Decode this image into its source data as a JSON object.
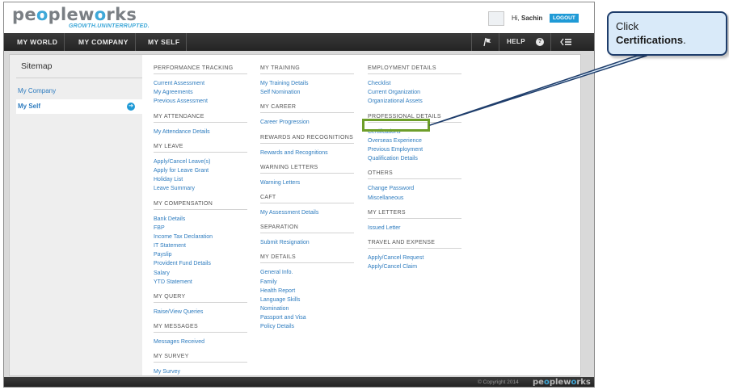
{
  "header": {
    "logo_word_a": "pe",
    "logo_word_b": "o",
    "logo_word_c": "ple",
    "logo_word_d": "w",
    "logo_word_e": "o",
    "logo_word_f": "rks",
    "tagline": "GROWTH.UNINTERRUPTED.",
    "greeting_prefix": "Hi, ",
    "user_name": "Sachin",
    "logout_label": "LOGOUT"
  },
  "nav": {
    "items": [
      "MY WORLD",
      "MY COMPANY",
      "MY SELF"
    ],
    "help_label": "HELP",
    "help_icon_glyph": "?"
  },
  "sidebar": {
    "title": "Sitemap",
    "items": [
      "My Company",
      "My Self"
    ],
    "active_arrow": "➔"
  },
  "columns": [
    [
      {
        "heading": "PERFORMANCE TRACKING",
        "links": [
          "Current Assessment",
          "My Agreements",
          "Previous Assessment"
        ]
      },
      {
        "heading": "MY ATTENDANCE",
        "links": [
          "My Attendance Details"
        ]
      },
      {
        "heading": "MY LEAVE",
        "links": [
          "Apply/Cancel Leave(s)",
          "Apply for Leave Grant",
          "Holiday List",
          "Leave Summary"
        ]
      },
      {
        "heading": "MY COMPENSATION",
        "links": [
          "Bank Details",
          "FBP",
          "Income Tax Declaration",
          "IT Statement",
          "Payslip",
          "Provident Fund Details",
          "Salary",
          "YTD Statement"
        ]
      },
      {
        "heading": "MY QUERY",
        "links": [
          "Raise/View Queries"
        ]
      },
      {
        "heading": "MY MESSAGES",
        "links": [
          "Messages Received"
        ]
      },
      {
        "heading": "MY SURVEY",
        "links": [
          "My Survey"
        ]
      }
    ],
    [
      {
        "heading": "MY TRAINING",
        "links": [
          "My Training Details",
          "Self Nomination"
        ]
      },
      {
        "heading": "MY CAREER",
        "links": [
          "Career Progression"
        ]
      },
      {
        "heading": "REWARDS AND RECOGNITIONS",
        "links": [
          "Rewards and Recognitions"
        ]
      },
      {
        "heading": "WARNING LETTERS",
        "links": [
          "Warning Letters"
        ]
      },
      {
        "heading": "CAFT",
        "links": [
          "My Assessment Details"
        ]
      },
      {
        "heading": "SEPARATION",
        "links": [
          "Submit Resignation"
        ]
      },
      {
        "heading": "MY DETAILS",
        "links": [
          "General Info.",
          "Family",
          "Health Report",
          "Language Skills",
          "Nomination",
          "Passport and Visa",
          "Policy Details"
        ]
      }
    ],
    [
      {
        "heading": "EMPLOYMENT DETAILS",
        "links": [
          "Checklist",
          "Current Organization",
          "Organizational Assets"
        ]
      },
      {
        "heading": "PROFESSIONAL DETAILS",
        "links": [
          "Certifications",
          "Overseas Experience",
          "Previous Employment",
          "Qualification Details"
        ]
      },
      {
        "heading": "OTHERS",
        "links": [
          "Change Password",
          "Miscellaneous"
        ]
      },
      {
        "heading": "MY LETTERS",
        "links": [
          "Issued Letter"
        ]
      },
      {
        "heading": "TRAVEL AND EXPENSE",
        "links": [
          "Apply/Cancel Request",
          "Apply/Cancel Claim"
        ]
      }
    ]
  ],
  "footer": {
    "copyright": "© Copyright 2014",
    "logo_a": "pe",
    "logo_b": "o",
    "logo_c": "ple",
    "logo_d": "w",
    "logo_e": "o",
    "logo_f": "rks"
  },
  "callout": {
    "line1": "Click",
    "target": "Certifications",
    "suffix": "."
  },
  "colors": {
    "link": "#2e7cbf",
    "brand_blue": "#3fa8d8",
    "highlight_green": "#6e9e2a",
    "callout_bg": "#d9eaf9",
    "callout_border": "#1e3d6b"
  },
  "icons": {
    "flag": "flag-icon",
    "help": "help-icon",
    "menu": "menu-icon",
    "arrow": "arrow-right-icon"
  }
}
